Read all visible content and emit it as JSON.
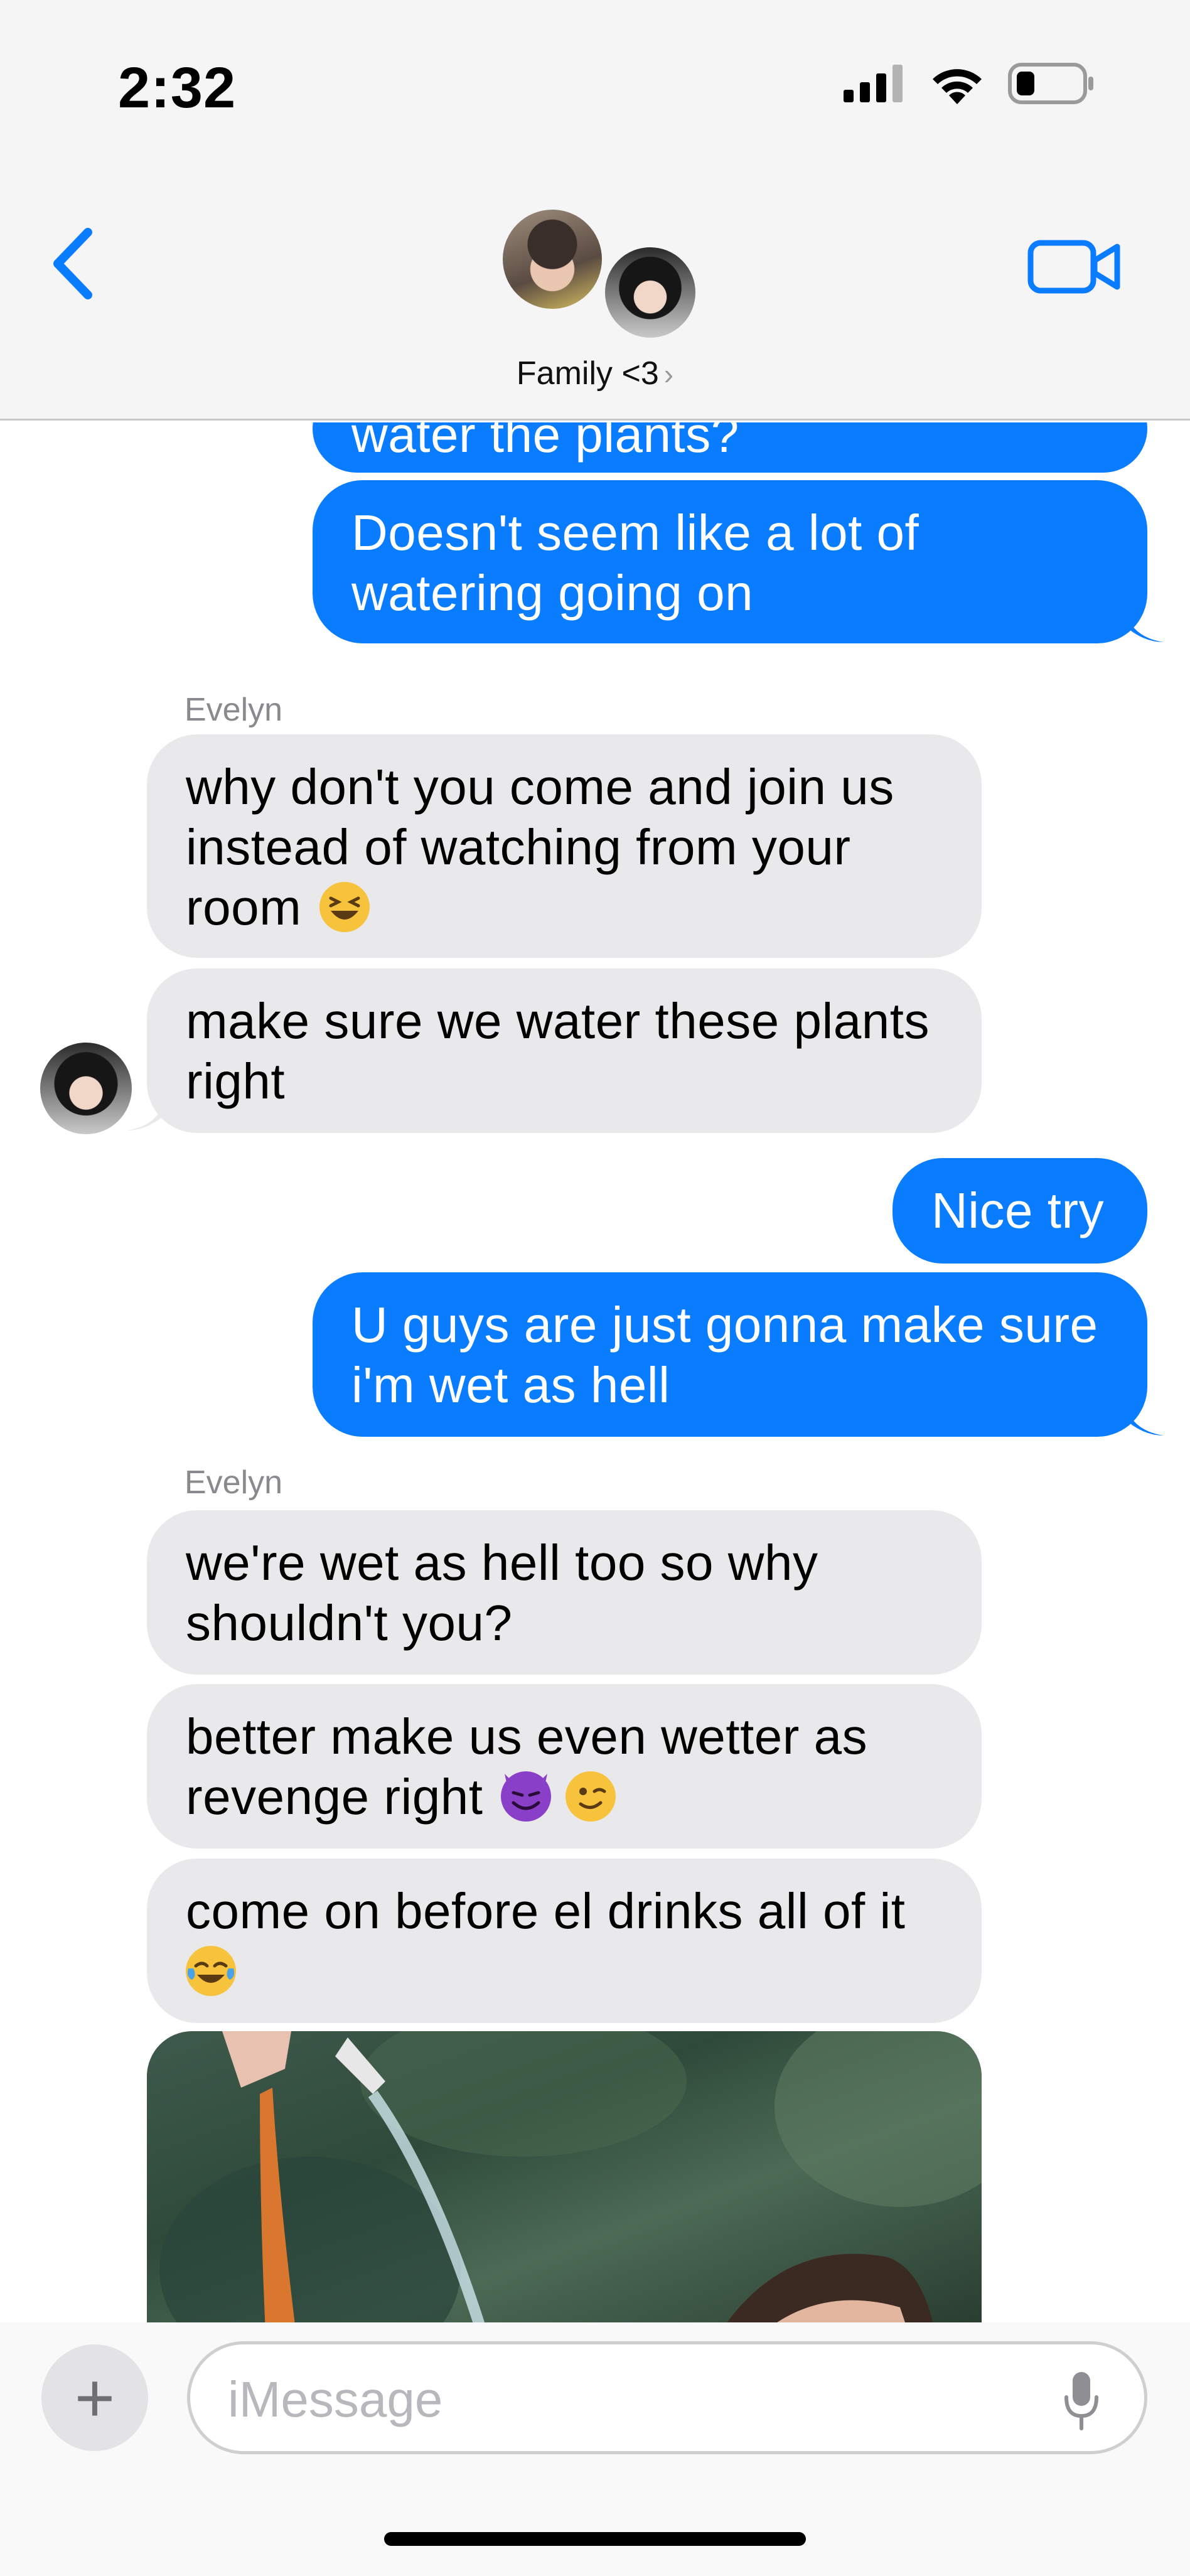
{
  "status_bar": {
    "time": "2:32"
  },
  "header": {
    "group_name": "Family <3",
    "chevron": "›",
    "back_icon": "chevron-left-icon",
    "video_icon": "video-camera-icon"
  },
  "messages": [
    {
      "direction": "outgoing",
      "text": "water the plants?"
    },
    {
      "direction": "outgoing",
      "text": "Doesn't seem like a lot of watering going on"
    },
    {
      "direction": "incoming",
      "sender": "Evelyn",
      "text": "why don't you come and join us instead of watching from your room",
      "emoji": "😆"
    },
    {
      "direction": "incoming",
      "text": "make sure we water these plants right"
    },
    {
      "direction": "outgoing",
      "text": "Nice try"
    },
    {
      "direction": "outgoing",
      "text": "U guys are just gonna make sure i'm wet as hell"
    },
    {
      "direction": "incoming",
      "sender": "Evelyn",
      "text": "we're wet as hell too so why shouldn't you?"
    },
    {
      "direction": "incoming",
      "text": "better make us even wetter as revenge right",
      "emoji": "😈😉"
    },
    {
      "direction": "incoming",
      "text": "come on before el drinks all of it",
      "emoji": "😂"
    },
    {
      "direction": "incoming",
      "type": "image"
    }
  ],
  "composer": {
    "placeholder": "iMessage",
    "plus_label": "+"
  },
  "colors": {
    "outgoing": "#0a7cff",
    "incoming": "#e9e9eb",
    "accent": "#0a7cff"
  }
}
